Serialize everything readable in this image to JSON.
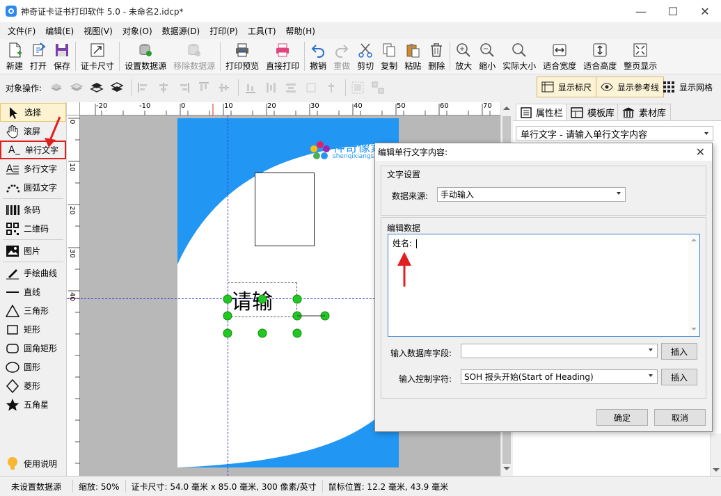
{
  "titlebar": {
    "title": "神奇证卡证书打印软件 5.0 - 未命名2.idcp*",
    "minimize": "—",
    "maximize": "☐",
    "close": "✕"
  },
  "menu": [
    "文件(F)",
    "编辑(E)",
    "视图(V)",
    "对象(O)",
    "数据源(D)",
    "打印(P)",
    "工具(T)",
    "帮助(H)"
  ],
  "toolbar": {
    "new": "新建",
    "open": "打开",
    "save": "保存",
    "card_size": "证卡尺寸",
    "set_datasource": "设置数据源",
    "remove_datasource": "移除数据源",
    "print_preview": "打印预览",
    "direct_print": "直接打印",
    "undo": "撤销",
    "redo": "重做",
    "cut": "剪切",
    "copy": "复制",
    "paste": "粘贴",
    "delete": "删除",
    "zoom_in": "放大",
    "zoom_out": "缩小",
    "actual_size": "实际大小",
    "fit_width": "适合宽度",
    "fit_height": "适合高度",
    "fit_page": "整页显示"
  },
  "toolbar2": {
    "label": "对象操作:",
    "show_ruler": "显示标尺",
    "show_guides": "显示参考线",
    "show_grid": "显示网格"
  },
  "tools": {
    "select": "选择",
    "scroll": "滚屏",
    "single_text": "单行文字",
    "multi_text": "多行文字",
    "arc_text": "圆弧文字",
    "barcode": "条码",
    "qrcode": "二维码",
    "image": "图片",
    "freehand": "手绘曲线",
    "line": "直线",
    "triangle": "三角形",
    "rect": "矩形",
    "round_rect": "圆角矩形",
    "ellipse": "圆形",
    "diamond": "菱形",
    "star": "五角星",
    "help": "使用说明"
  },
  "ruler": {
    "h_labels": [
      "-20",
      "-10",
      "0",
      "10",
      "20",
      "30",
      "40",
      "50",
      "60",
      "70"
    ],
    "v_labels": [
      "0",
      "10",
      "20",
      "30",
      "40"
    ]
  },
  "card": {
    "logo_text": "神奇像素",
    "logo_sub": "shenqixiangsu",
    "text_object": "请输"
  },
  "rightpanel": {
    "tab_props": "属性栏",
    "tab_templates": "模板库",
    "tab_materials": "素材库",
    "object_desc": "单行文字 - 请输入单行文字内容"
  },
  "dialog": {
    "title": "编辑单行文字内容:",
    "text_settings": "文字设置",
    "datasource_label": "数据来源:",
    "datasource_value": "手动输入",
    "edit_data": "编辑数据",
    "text_value": "姓名:",
    "db_field_label": "输入数据库字段:",
    "db_field_value": "",
    "insert1": "插入",
    "ctrl_char_label": "输入控制字符:",
    "ctrl_char_value": "SOH  报头开始(Start of Heading)",
    "insert2": "插入",
    "ok": "确定",
    "cancel": "取消"
  },
  "status": {
    "datasource": "未设置数据源",
    "zoom": "缩放: 50%",
    "card_size": "证卡尺寸: 54.0 毫米 x 85.0 毫米, 300 像素/英寸",
    "mouse": "鼠标位置: 12.2 毫米, 43.9 毫米"
  },
  "colors": {
    "accent": "#2196f3",
    "handle": "#22c822",
    "highlight": "#e02020"
  }
}
